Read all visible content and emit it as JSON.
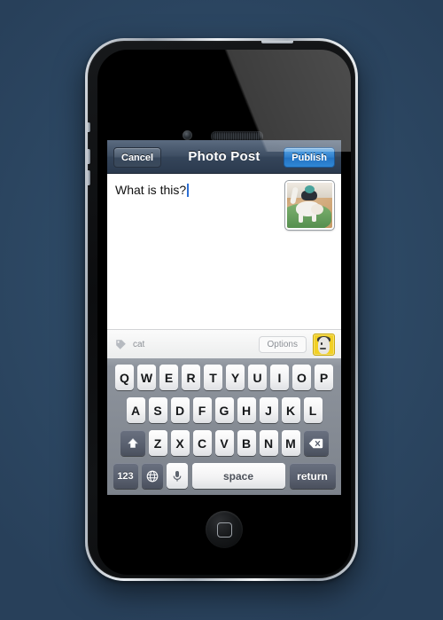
{
  "device": {
    "name": "iPhone 4",
    "hardware": {
      "front_camera": "front-camera",
      "earpiece": "earpiece-speaker",
      "home_button": "home-button",
      "volume_up": "volume-up-button",
      "volume_down": "volume-down-button",
      "ring_switch": "ring-silent-switch",
      "power_button": "power-button"
    }
  },
  "background": {
    "color": "#2d4966",
    "accent": "#375571"
  },
  "app": {
    "navbar": {
      "title": "Photo Post",
      "cancel_label": "Cancel",
      "publish_label": "Publish",
      "publish_color": "#2f7fcd",
      "bar_color": "#3e4e63"
    },
    "compose": {
      "text": "What is this?",
      "caret_visible": true,
      "thumbnail_alt": "white cat on green rug"
    },
    "toolbar": {
      "tag_icon": "tag-icon",
      "tag_label": "cat",
      "options_label": "Options",
      "avatar_alt": "cartoon face avatar",
      "avatar_color": "#f2d024"
    }
  },
  "keyboard": {
    "layout": "qwerty-uppercase",
    "background": "#8d939c",
    "rows": [
      {
        "keys": [
          "Q",
          "W",
          "E",
          "R",
          "T",
          "Y",
          "U",
          "I",
          "O",
          "P"
        ]
      },
      {
        "keys": [
          "A",
          "S",
          "D",
          "F",
          "G",
          "H",
          "J",
          "K",
          "L"
        ]
      },
      {
        "keys": [
          "Z",
          "X",
          "C",
          "V",
          "B",
          "N",
          "M"
        ]
      }
    ],
    "shift_label": "⇧",
    "delete_label": "⌫",
    "numeric_label": "123",
    "globe_label": "🌐",
    "mic_label": "🎤",
    "space_label": "space",
    "return_label": "return"
  }
}
